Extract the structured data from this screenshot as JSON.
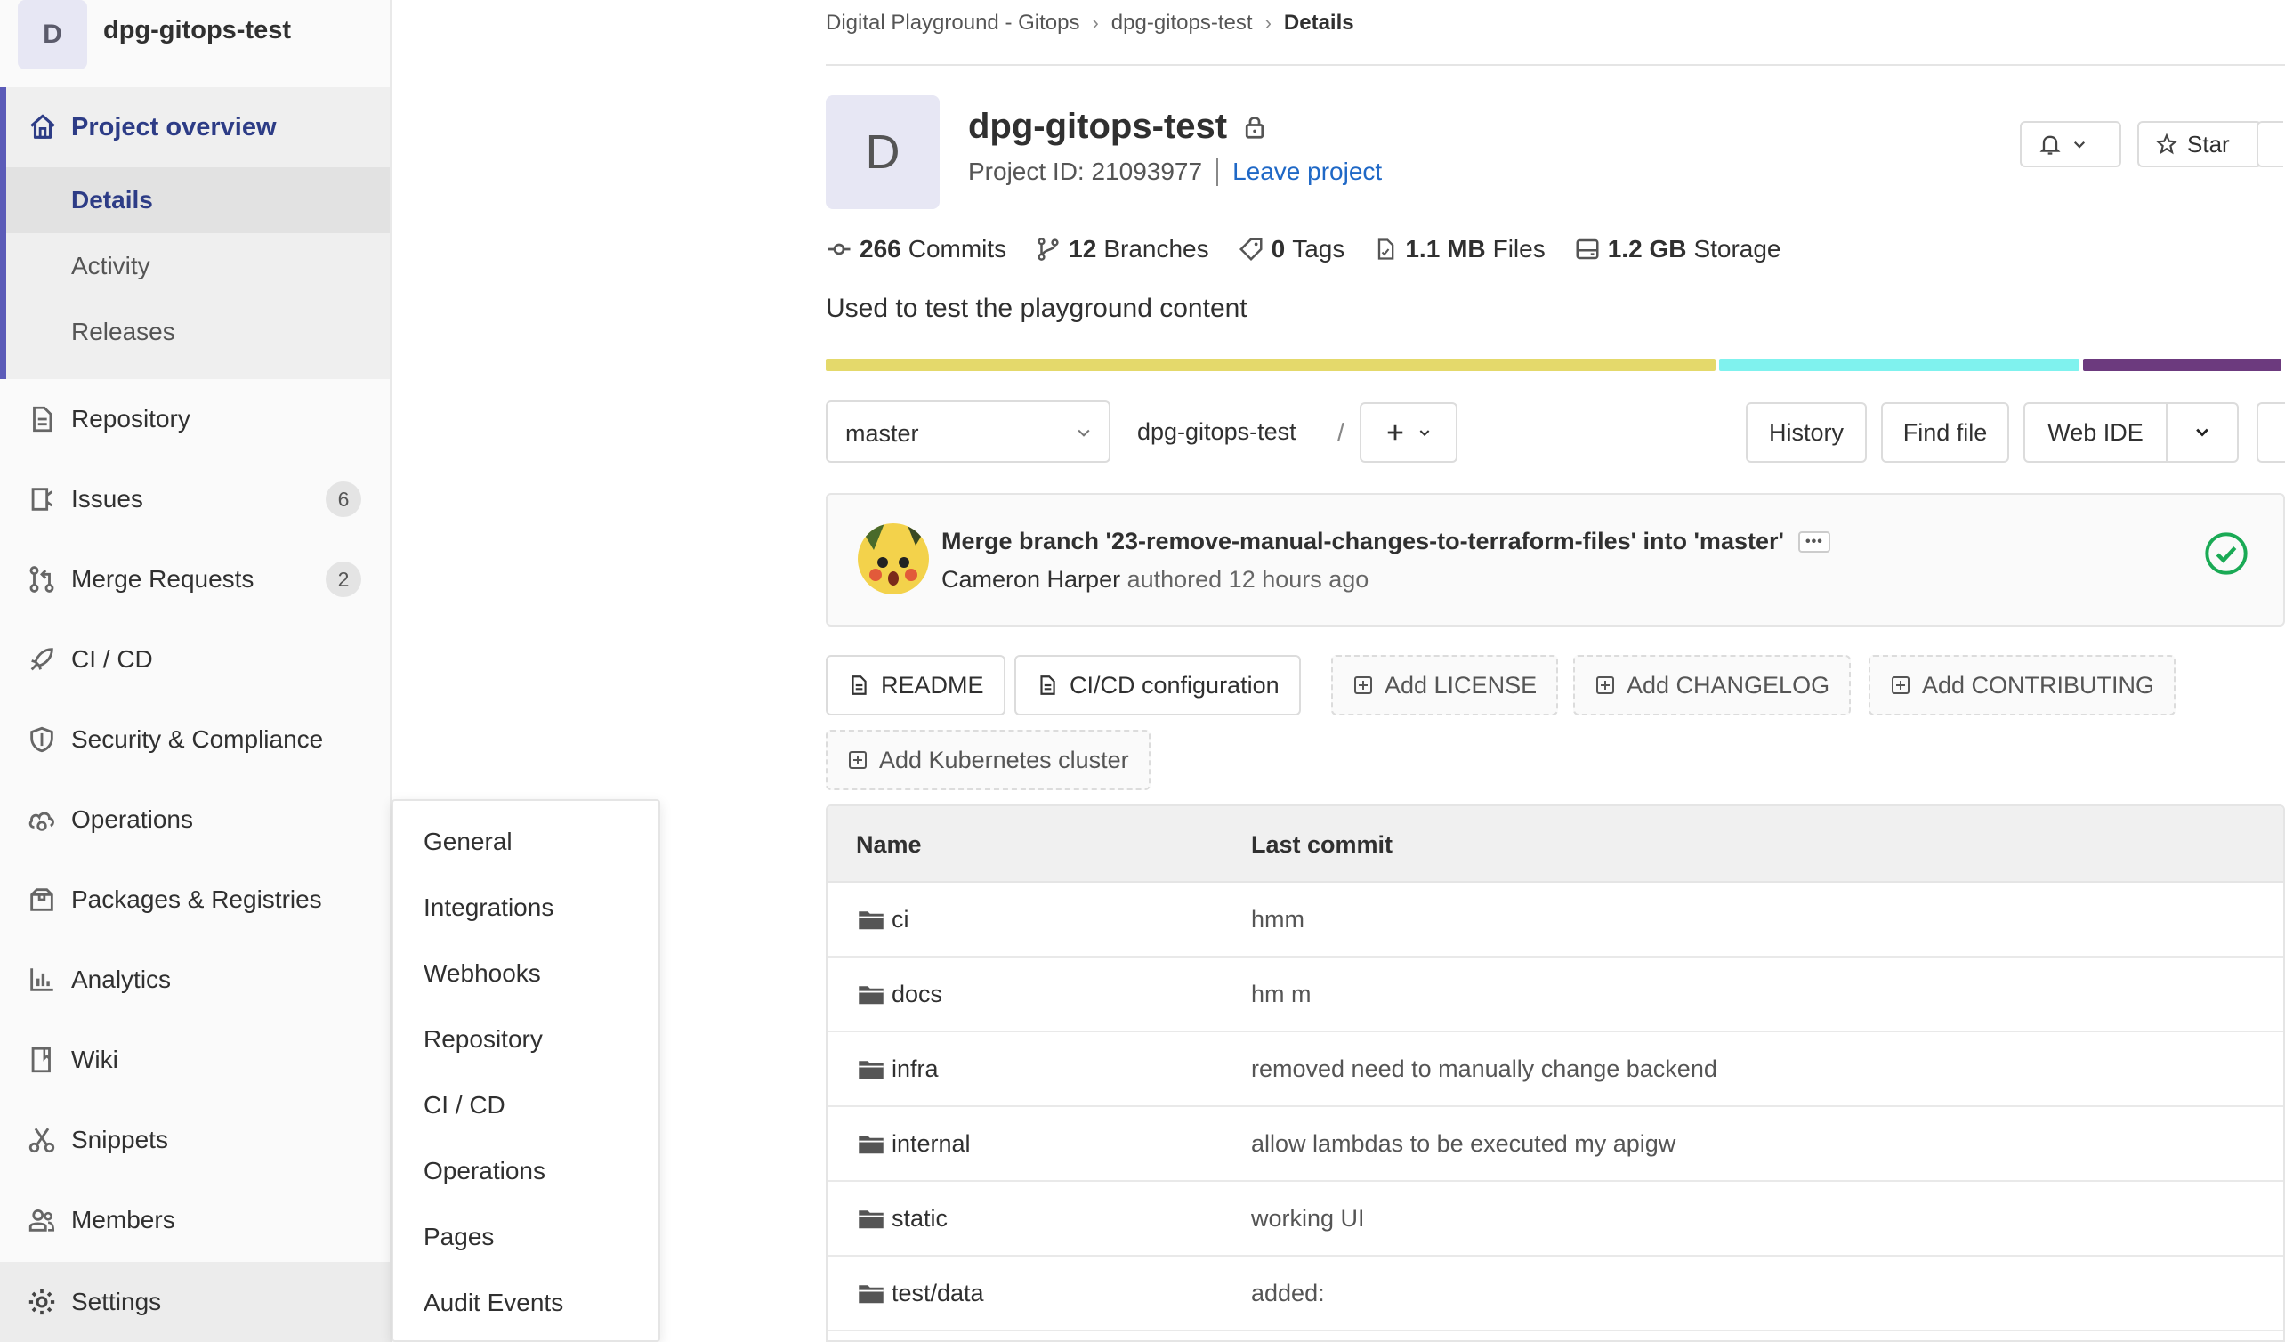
{
  "project": {
    "initial": "D",
    "name": "dpg-gitops-test",
    "id_text": "Project ID: 21093977",
    "leave": "Leave project",
    "description": "Used to test the playground content"
  },
  "sidebar": {
    "group_title": "Project overview",
    "sub_items": [
      {
        "label": "Details"
      },
      {
        "label": "Activity"
      },
      {
        "label": "Releases"
      }
    ],
    "items": [
      {
        "label": "Repository",
        "icon": "doc-icon"
      },
      {
        "label": "Issues",
        "icon": "issues-icon",
        "badge": "6"
      },
      {
        "label": "Merge Requests",
        "icon": "merge-request-icon",
        "badge": "2"
      },
      {
        "label": "CI / CD",
        "icon": "rocket-icon"
      },
      {
        "label": "Security & Compliance",
        "icon": "shield-icon"
      },
      {
        "label": "Operations",
        "icon": "cloud-gear-icon"
      },
      {
        "label": "Packages & Registries",
        "icon": "package-icon"
      },
      {
        "label": "Analytics",
        "icon": "chart-icon"
      },
      {
        "label": "Wiki",
        "icon": "book-icon"
      },
      {
        "label": "Snippets",
        "icon": "scissors-icon"
      },
      {
        "label": "Members",
        "icon": "users-icon"
      },
      {
        "label": "Settings",
        "icon": "gear-icon"
      }
    ]
  },
  "settings_menu": [
    "General",
    "Integrations",
    "Webhooks",
    "Repository",
    "CI / CD",
    "Operations",
    "Pages",
    "Audit Events"
  ],
  "breadcrumb": [
    "Digital Playground - Gitops",
    "dpg-gitops-test",
    "Details"
  ],
  "stats": [
    {
      "num": "266",
      "label": "Commits"
    },
    {
      "num": "12",
      "label": "Branches"
    },
    {
      "num": "0",
      "label": "Tags"
    },
    {
      "num": "1.1 MB",
      "label": "Files"
    },
    {
      "num": "1.2 GB",
      "label": "Storage"
    }
  ],
  "languages": [
    {
      "color": "#e4d96b"
    },
    {
      "color": "#7ff2ee"
    },
    {
      "color": "#6c3a7e"
    }
  ],
  "toolbar": {
    "branch": "master",
    "path": "dpg-gitops-test",
    "slash": "/",
    "history": "History",
    "find_file": "Find file",
    "web_ide": "Web IDE",
    "star": "Star"
  },
  "commit": {
    "title": "Merge branch '23-remove-manual-changes-to-terraform-files' into 'master'",
    "author": "Cameron Harper",
    "meta": "authored 12 hours ago"
  },
  "quick_buttons": [
    "README",
    "CI/CD configuration",
    "Add LICENSE",
    "Add CHANGELOG",
    "Add CONTRIBUTING",
    "Add Kubernetes cluster"
  ],
  "table": {
    "headers": [
      "Name",
      "Last commit"
    ],
    "rows": [
      {
        "name": "ci",
        "msg": "hmm"
      },
      {
        "name": "docs",
        "msg": "hm m"
      },
      {
        "name": "infra",
        "msg": "removed need to manually change backend"
      },
      {
        "name": "internal",
        "msg": "allow lambdas to be executed my apigw"
      },
      {
        "name": "static",
        "msg": "working UI"
      },
      {
        "name": "test/data",
        "msg": "added:"
      }
    ]
  }
}
